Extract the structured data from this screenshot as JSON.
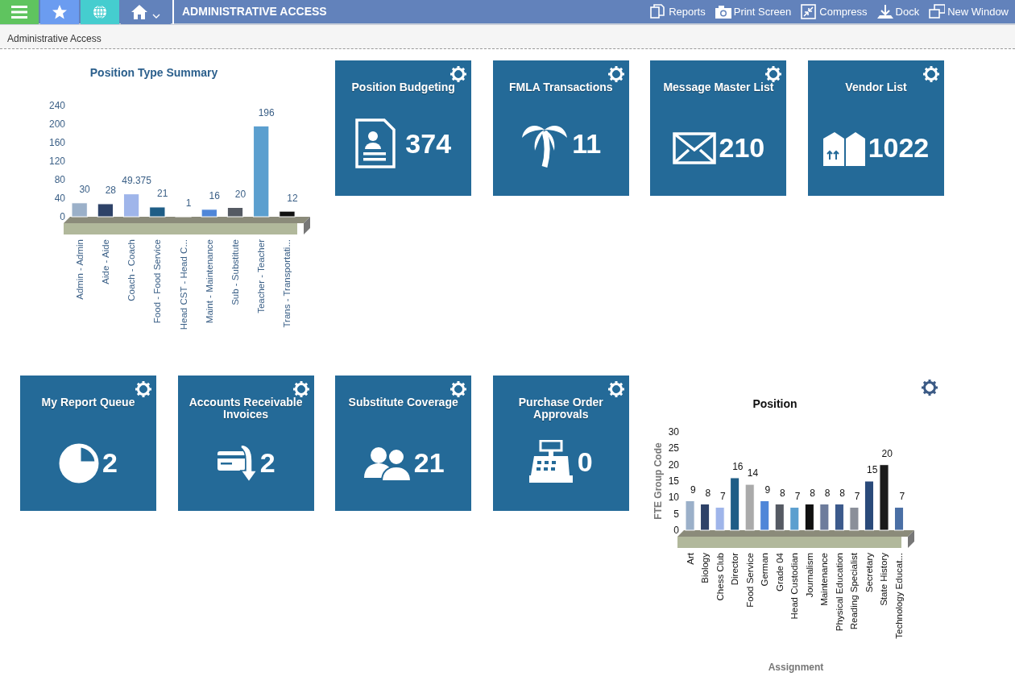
{
  "toolbar": {
    "title": "ADMINISTRATIVE ACCESS",
    "actions": [
      {
        "kind": "reports",
        "label": "Reports"
      },
      {
        "kind": "print",
        "label": "Print Screen"
      },
      {
        "kind": "compress",
        "label": "Compress"
      },
      {
        "kind": "dock",
        "label": "Dock"
      },
      {
        "kind": "window",
        "label": "New Window"
      }
    ]
  },
  "breadcrumb": "Administrative Access",
  "widgets": [
    {
      "kind": "chart",
      "chart_data": {
        "type": "bar",
        "title": "Position Type Summary",
        "categories": [
          "Admin - Admin",
          "Aide - Aide",
          "Coach - Coach",
          "Food - Food Service",
          "Head CST - Head C...",
          "Maint - Maintenance",
          "Sub - Substitute",
          "Teacher - Teacher",
          "Trans - Transportati..."
        ],
        "values": [
          30,
          28,
          49.375,
          21,
          1,
          16,
          20,
          196,
          12
        ],
        "yticks": [
          0,
          40,
          80,
          120,
          160,
          200,
          240
        ],
        "ylim": [
          0,
          240
        ],
        "data_labels": true
      }
    },
    {
      "kind": "tile",
      "title": "Position Budgeting",
      "count": "374"
    },
    {
      "kind": "tile",
      "title": "FMLA Transactions",
      "count": "11"
    },
    {
      "kind": "tile",
      "title": "Message Master List",
      "count": "210"
    },
    {
      "kind": "tile",
      "title": "Vendor List",
      "count": "1022"
    },
    {
      "kind": "tile",
      "title": "My Report Queue",
      "count": "2"
    },
    {
      "kind": "tile",
      "title": "Accounts Receivable Invoices",
      "count": "2"
    },
    {
      "kind": "tile",
      "title": "Substitute Coverage",
      "count": "21"
    },
    {
      "kind": "tile",
      "title": "Purchase Order Approvals",
      "count": "0"
    },
    {
      "kind": "chart",
      "chart_data": {
        "type": "bar",
        "title": "Position",
        "xlabel": "Assignment",
        "ylabel": "FTE Group Code",
        "categories": [
          "Art",
          "Biology",
          "Chess Club",
          "Director",
          "Food Service",
          "German",
          "Grade 04",
          "Head Custodian",
          "Journalism",
          "Maintenance",
          "Physical Education",
          "Reading Specialist",
          "Secretary",
          "State History",
          "Technology Educat..."
        ],
        "values": [
          9,
          8,
          7,
          16,
          14,
          9,
          8,
          7,
          8,
          8,
          8,
          7,
          15,
          20,
          7
        ],
        "yticks": [
          0,
          5,
          10,
          15,
          20,
          25,
          30
        ],
        "ylim": [
          0,
          30
        ],
        "data_labels": true
      }
    }
  ]
}
